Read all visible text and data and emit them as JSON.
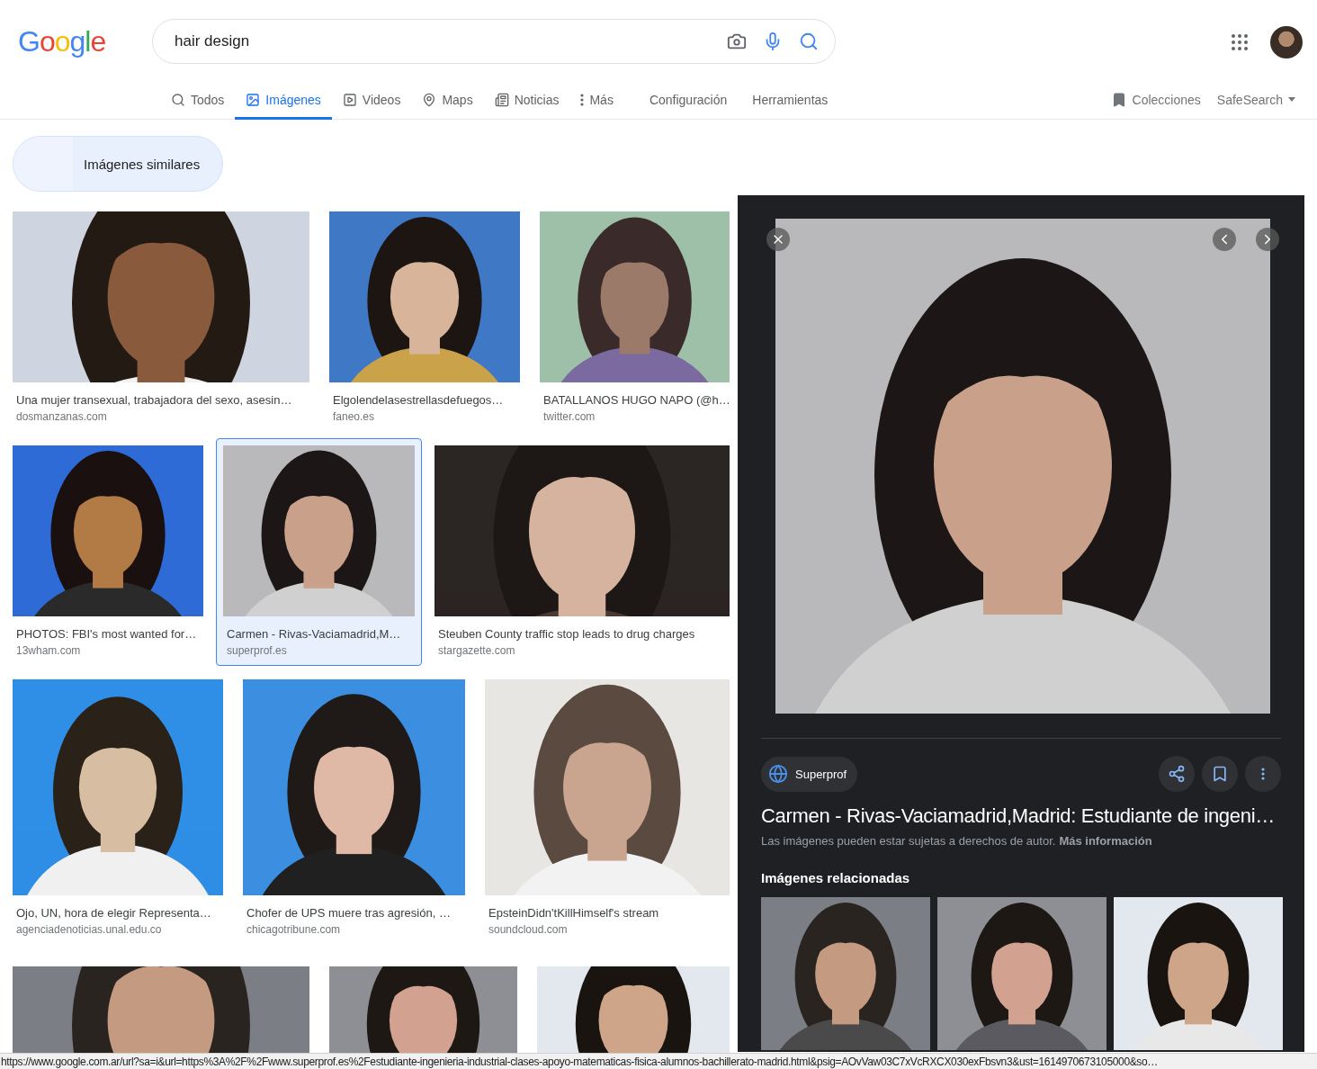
{
  "logo": {
    "text": "Google"
  },
  "search": {
    "value": "hair design"
  },
  "tabs": [
    {
      "label": "Todos",
      "kind": "search",
      "selected": false
    },
    {
      "label": "Imágenes",
      "kind": "images",
      "selected": true
    },
    {
      "label": "Videos",
      "kind": "videos",
      "selected": false
    },
    {
      "label": "Maps",
      "kind": "maps",
      "selected": false
    },
    {
      "label": "Noticias",
      "kind": "news",
      "selected": false
    },
    {
      "label": "Más",
      "kind": "more",
      "selected": false
    }
  ],
  "tools": [
    "Configuración",
    "Herramientas"
  ],
  "collections": "Colecciones",
  "safesearch": "SafeSearch",
  "similar_chip": "Imágenes similares",
  "result_rows": [
    [
      {
        "title": "Una mujer transexual, trabajadora del sexo, asesin…",
        "source": "dosmanzanas.com",
        "selected": false
      },
      {
        "title": "Elgolendelasestrellasdefuegos…",
        "source": "faneo.es",
        "selected": false
      },
      {
        "title": "BATALLANOS HUGO NAPO (@h…",
        "source": "twitter.com",
        "selected": false
      }
    ],
    [
      {
        "title": "PHOTOS: FBI's most wanted for…",
        "source": "13wham.com",
        "selected": false
      },
      {
        "title": "Carmen - Rivas-Vaciamadrid,M…",
        "source": "superprof.es",
        "selected": true
      },
      {
        "title": "Steuben County traffic stop leads to drug charges",
        "source": "stargazette.com",
        "selected": false
      }
    ],
    [
      {
        "title": "Ojo, UN, hora de elegir Representa…",
        "source": "agenciadenoticias.unal.edu.co",
        "selected": false
      },
      {
        "title": "Chofer de UPS muere tras agresión, …",
        "source": "chicagotribune.com",
        "selected": false
      },
      {
        "title": "EpsteinDidn'tKillHimself's stream",
        "source": "soundcloud.com",
        "selected": false
      }
    ],
    [
      {
        "selected": false
      },
      {
        "selected": false
      },
      {
        "selected": false
      }
    ]
  ],
  "preview": {
    "source": "Superprof",
    "title": "Carmen - Rivas-Vaciamadrid,Madrid: Estudiante de ingeni…",
    "notice": "Las imágenes pueden estar sujetas a derechos de autor.",
    "notice_link": "Más información",
    "related_heading": "Imágenes relacionadas"
  },
  "status_bar": "https://www.google.com.ar/url?sa=i&url=https%3A%2F%2Fwww.superprof.es%2Festudiante-ingenieria-industrial-clases-apoyo-matematicas-fisica-alumnos-bachillerato-madrid.html&psig=AOvVaw03C7xVcRXCX030exFbsvn3&ust=1614970673105000&so…"
}
